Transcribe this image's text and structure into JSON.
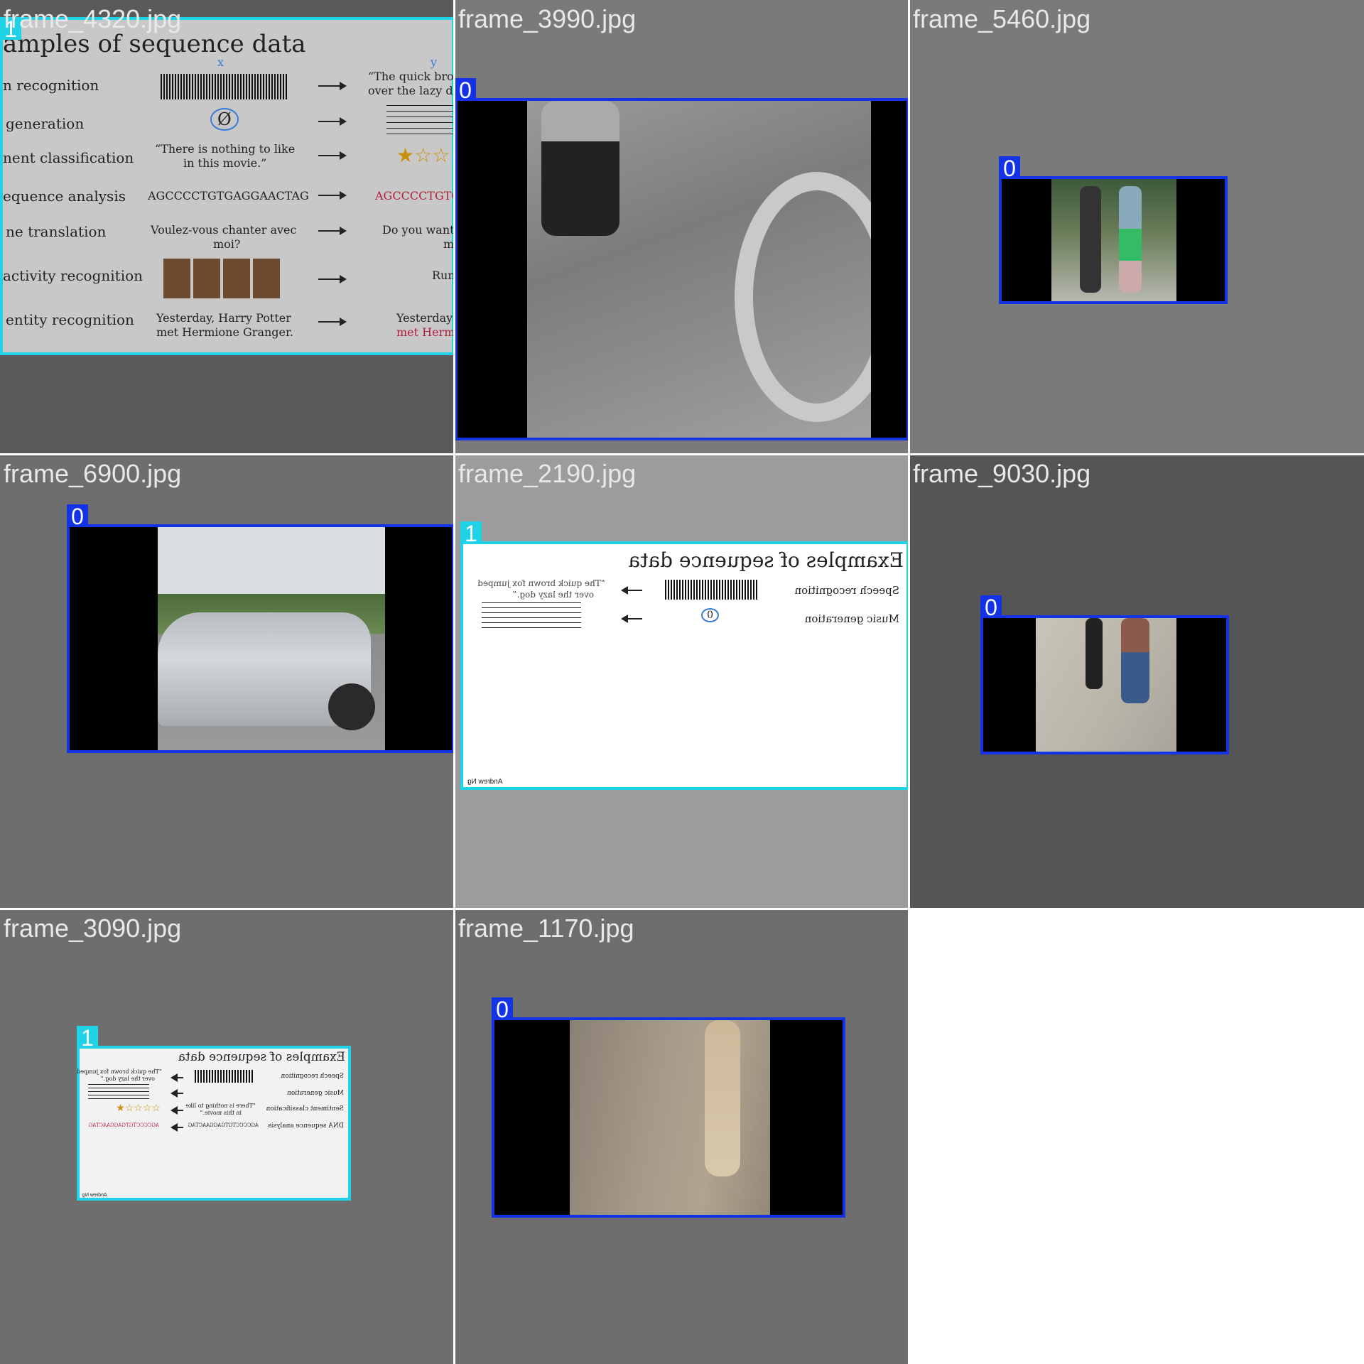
{
  "colors": {
    "class0": "#1432e6",
    "class1": "#1fd2e6"
  },
  "tiles": [
    {
      "file": "frame_4320.jpg",
      "label": "1",
      "slide": {
        "title": "amples of sequence data",
        "x_mark": "x",
        "y_mark": "y",
        "rows": [
          {
            "name": "n recognition",
            "input": "",
            "output": "“The quick brow"
          },
          {
            "name": "generation",
            "input": "Ø",
            "output": ""
          },
          {
            "name": "nent classification",
            "input": "“There is nothing to like",
            "output": "★☆☆"
          },
          {
            "name": "equence analysis",
            "input": "AGCCCCTGTGAGGAACTAG",
            "output": "AGCCCCTGTG"
          },
          {
            "name": "ne translation",
            "input": "Voulez-vous chanter avec",
            "output": "Do you want"
          },
          {
            "name": "activity recognition",
            "input": "",
            "output": "Run"
          },
          {
            "name": "entity recognition",
            "input": "Yesterday, Harry Potter",
            "output": "Yesterday"
          }
        ],
        "extra": {
          "in_line2_a": "in this movie.”",
          "in_line2_b": "moi?",
          "in_line2_c": "met Hermione Granger.",
          "out_line2_a": "over the lazy d",
          "out_line2_b": "m",
          "out_line2_c": "met Herm"
        }
      }
    },
    {
      "file": "frame_3990.jpg",
      "label": "0"
    },
    {
      "file": "frame_5460.jpg",
      "label": "0"
    },
    {
      "file": "frame_6900.jpg",
      "label": "0"
    },
    {
      "file": "frame_2190.jpg",
      "label": "1",
      "slide": {
        "title": "Examples of sequence data",
        "row1": "Speech recognition",
        "row2": "Music generation",
        "out1": "“The quick brown fox jumped",
        "out1b": "over the lazy dog.”",
        "circle": "0",
        "author": "Andrew Ng"
      }
    },
    {
      "file": "frame_9030.jpg",
      "label": "0"
    },
    {
      "file": "frame_3090.jpg",
      "label": "1",
      "slide": {
        "title": "Examples of sequence data",
        "rows": [
          "Speech recognition",
          "Music generation",
          "Sentiment classification",
          "DNA sequence analysis"
        ],
        "in3": "“There is nothing to like",
        "in3b": "in this movie.”",
        "in4": "AGCCCCTGTGAGGAACTAG",
        "out1": "“The quick brown fox jumped",
        "out1b": "over the lazy dog.”",
        "out4": "AGCCCCTGTGAGGAACTAG",
        "stars": "☆☆☆☆★",
        "author": "Andrew Ng"
      }
    },
    {
      "file": "frame_1170.jpg",
      "label": "0"
    }
  ]
}
